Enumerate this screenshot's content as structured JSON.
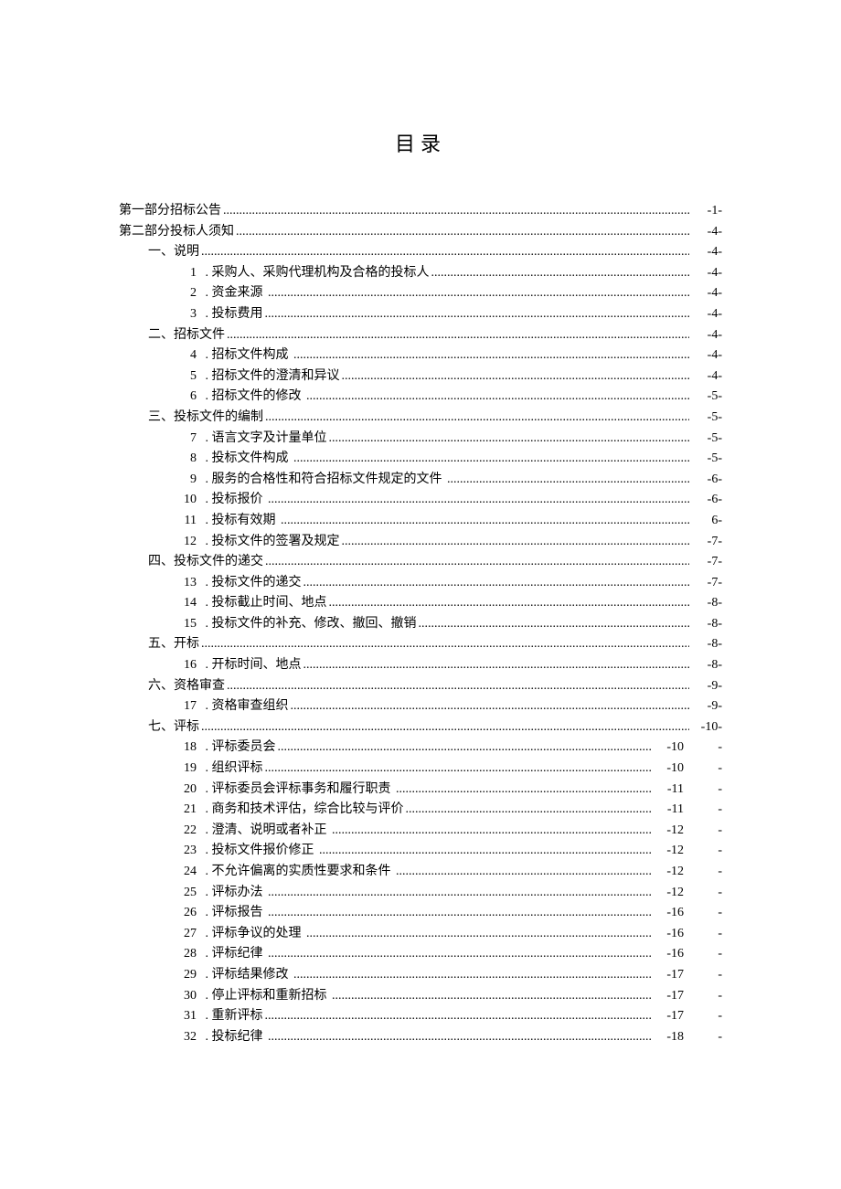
{
  "title": "目录",
  "entries": [
    {
      "indent": 0,
      "num": "",
      "label": "第一部分招标公告",
      "page": "-1-",
      "dashAfter": false
    },
    {
      "indent": 0,
      "num": "",
      "label": "第二部分投标人须知",
      "page": "-4-",
      "dashAfter": false
    },
    {
      "indent": 1,
      "num": "",
      "label": "一、说明",
      "page": "-4-",
      "dashAfter": false
    },
    {
      "indent": 2,
      "num": "1",
      "label": " . 采购人、采购代理机构及合格的投标人",
      "page": "-4-",
      "dashAfter": false
    },
    {
      "indent": 2,
      "num": "2",
      "label": " . 资金来源 ",
      "page": "-4-",
      "dashAfter": false
    },
    {
      "indent": 2,
      "num": "3",
      "label": " . 投标费用",
      "page": "-4-",
      "dashAfter": false
    },
    {
      "indent": 1,
      "num": "",
      "label": "二、招标文件",
      "page": "-4-",
      "dashAfter": false
    },
    {
      "indent": 2,
      "num": "4",
      "label": " . 招标文件构成 ",
      "page": "-4-",
      "dashAfter": false
    },
    {
      "indent": 2,
      "num": "5",
      "label": " . 招标文件的澄清和异议",
      "page": "-4-",
      "dashAfter": false
    },
    {
      "indent": 2,
      "num": "6",
      "label": " . 招标文件的修改 ",
      "page": "-5-",
      "dashAfter": false
    },
    {
      "indent": 1,
      "num": "",
      "label": "三、投标文件的编制",
      "page": "-5-",
      "dashAfter": false
    },
    {
      "indent": 2,
      "num": "7",
      "label": " . 语言文字及计量单位",
      "page": "-5-",
      "dashAfter": false
    },
    {
      "indent": 2,
      "num": "8",
      "label": " . 投标文件构成 ",
      "page": "-5-",
      "dashAfter": false
    },
    {
      "indent": 2,
      "num": "9",
      "label": " . 服务的合格性和符合招标文件规定的文件 ",
      "page": "-6-",
      "dashAfter": false
    },
    {
      "indent": 2,
      "num": "10",
      "label": " . 投标报价 ",
      "page": "-6-",
      "dashAfter": false
    },
    {
      "indent": 2,
      "num": "11",
      "label": " . 投标有效期 ",
      "page": " 6-",
      "dashAfter": false
    },
    {
      "indent": 2,
      "num": "12",
      "label": " . 投标文件的签署及规定",
      "page": "-7-",
      "dashAfter": false
    },
    {
      "indent": 1,
      "num": "",
      "label": "四、投标文件的递交",
      "page": "-7-",
      "dashAfter": false
    },
    {
      "indent": 2,
      "num": "13",
      "label": " . 投标文件的递交",
      "page": "-7-",
      "dashAfter": false
    },
    {
      "indent": 2,
      "num": "14",
      "label": " . 投标截止时间、地点",
      "page": "-8-",
      "dashAfter": false
    },
    {
      "indent": 2,
      "num": "15",
      "label": " . 投标文件的补充、修改、撤回、撤销",
      "page": "-8-",
      "dashAfter": false
    },
    {
      "indent": 1,
      "num": "",
      "label": "五、开标",
      "page": "-8-",
      "dashAfter": false
    },
    {
      "indent": 2,
      "num": "16",
      "label": " . 开标时间、地点",
      "page": "-8-",
      "dashAfter": false
    },
    {
      "indent": 1,
      "num": "",
      "label": "六、资格审查",
      "page": "-9-",
      "dashAfter": false
    },
    {
      "indent": 2,
      "num": "17",
      "label": " . 资格审查组织",
      "page": "-9-",
      "dashAfter": false
    },
    {
      "indent": 1,
      "num": "",
      "label": "七、评标",
      "page": "-10-",
      "dashAfter": false
    },
    {
      "indent": 2,
      "num": "18",
      "label": " . 评标委员会",
      "page": "-10",
      "dashAfter": true
    },
    {
      "indent": 2,
      "num": "19",
      "label": " . 组织评标",
      "page": "-10",
      "dashAfter": true
    },
    {
      "indent": 2,
      "num": "20",
      "label": " . 评标委员会评标事务和履行职责 ",
      "page": "-11",
      "dashAfter": true
    },
    {
      "indent": 2,
      "num": "21",
      "label": " . 商务和技术评估，综合比较与评价",
      "page": "-11",
      "dashAfter": true
    },
    {
      "indent": 2,
      "num": "22",
      "label": " . 澄清、说明或者补正 ",
      "page": "-12",
      "dashAfter": true
    },
    {
      "indent": 2,
      "num": "23",
      "label": " . 投标文件报价修正 ",
      "page": "-12",
      "dashAfter": true
    },
    {
      "indent": 2,
      "num": "24",
      "label": " . 不允许偏离的实质性要求和条件 ",
      "page": "-12",
      "dashAfter": true
    },
    {
      "indent": 2,
      "num": "25",
      "label": " . 评标办法 ",
      "page": "-12",
      "dashAfter": true
    },
    {
      "indent": 2,
      "num": "26",
      "label": " . 评标报告 ",
      "page": "-16",
      "dashAfter": true
    },
    {
      "indent": 2,
      "num": "27",
      "label": " . 评标争议的处理 ",
      "page": "-16",
      "dashAfter": true
    },
    {
      "indent": 2,
      "num": "28",
      "label": " . 评标纪律 ",
      "page": "-16",
      "dashAfter": true
    },
    {
      "indent": 2,
      "num": "29",
      "label": " . 评标结果修改 ",
      "page": "-17",
      "dashAfter": true
    },
    {
      "indent": 2,
      "num": "30",
      "label": " . 停止评标和重新招标 ",
      "page": "-17",
      "dashAfter": true
    },
    {
      "indent": 2,
      "num": "31",
      "label": " . 重新评标",
      "page": "-17",
      "dashAfter": true
    },
    {
      "indent": 2,
      "num": "32",
      "label": " . 投标纪律 ",
      "page": "-18",
      "dashAfter": true
    }
  ],
  "dashGlyph": "-"
}
